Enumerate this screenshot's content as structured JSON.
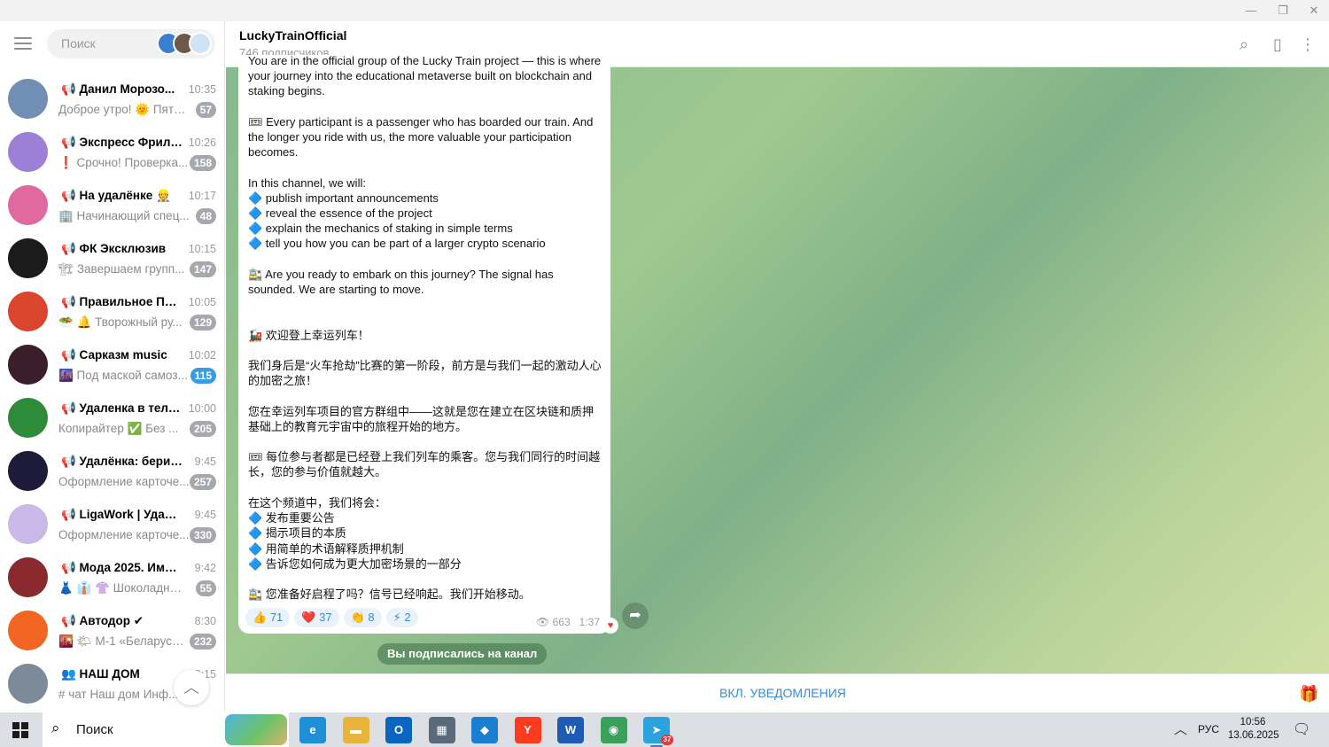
{
  "window": {
    "minimize": "—",
    "maximize": "❐",
    "close": "✕"
  },
  "sidebar": {
    "search_placeholder": "Поиск",
    "chats": [
      {
        "name": "📢 Данил Морозо...",
        "time": "10:35",
        "preview": "Доброе утро! 🌞 Пятн...",
        "unread": "57",
        "avatar_color": "#6f8fb4",
        "badge_color": "#a5a9ae"
      },
      {
        "name": "📢 Экспресс Фриланс",
        "time": "10:26",
        "preview": "❗ Срочно! Проверка...",
        "unread": "158",
        "avatar_color": "#9c7fd6",
        "badge_color": "#a5a9ae"
      },
      {
        "name": "📢 На удалёнке 👷",
        "time": "10:17",
        "preview": "🏢 Начинающий спец...",
        "unread": "48",
        "avatar_color": "#e06aa0",
        "badge_color": "#a5a9ae"
      },
      {
        "name": "📢 ФК Эксклюзив",
        "time": "10:15",
        "preview": "🏗 Завершаем групп...",
        "unread": "147",
        "avatar_color": "#1b1b1b",
        "badge_color": "#a5a9ae"
      },
      {
        "name": "📢 Правильное Пита...",
        "time": "10:05",
        "preview": "🥗 🔔 Творожный ру...",
        "unread": "129",
        "avatar_color": "#d9462d",
        "badge_color": "#a5a9ae"
      },
      {
        "name": "📢 Сарказм music",
        "time": "10:02",
        "preview": "🌆 Под маской самоз...",
        "unread": "115",
        "avatar_color": "#3a1f2b",
        "badge_color": "#3b9be0"
      },
      {
        "name": "📢 Удаленка в телеф...",
        "time": "10:00",
        "preview": "Копирайтер ✅ Без ...",
        "unread": "205",
        "avatar_color": "#2e8b3a",
        "badge_color": "#a5a9ae"
      },
      {
        "name": "📢 Удалёнка: бери и д...",
        "time": "9:45",
        "preview": "Оформление карточе...",
        "unread": "257",
        "avatar_color": "#1e1b3a",
        "badge_color": "#a5a9ae"
      },
      {
        "name": "📢 LigaWork | Удалёнк...",
        "time": "9:45",
        "preview": "Оформление карточе...",
        "unread": "330",
        "avatar_color": "#c9b8e8",
        "badge_color": "#a5a9ae"
      },
      {
        "name": "📢 Мода 2025. Имидж ...",
        "time": "9:42",
        "preview": "👗 👔 👚 Шоколадный ...",
        "unread": "55",
        "avatar_color": "#8a2a2e",
        "badge_color": "#a5a9ae"
      },
      {
        "name": "📢 Автодор ✔",
        "time": "8:30",
        "preview": "🌇 🌤 М-1 «Беларусь»...",
        "unread": "232",
        "avatar_color": "#f26522",
        "badge_color": "#a5a9ae"
      },
      {
        "name": "👥 НАШ ДОМ",
        "time": "8:15",
        "preview": "# чат Наш дом   Инф...",
        "unread": "",
        "avatar_color": "#7d8a99",
        "badge_color": "#a5a9ae"
      }
    ]
  },
  "header": {
    "title": "LuckyTrainOfficial",
    "subtitle": "746 подписчиков"
  },
  "message": {
    "text": "You are in the official group of the Lucky Train project — this is where your journey into the educational metaverse built on blockchain and staking begins.\n\n🎟 Every participant is a passenger who has boarded our train. And the longer you ride with us, the more valuable your participation becomes.\n\nIn this channel, we will:\n🔷 publish important announcements\n🔷 reveal the essence of the project\n🔷 explain the mechanics of staking in simple terms\n🔷 tell you how you can be part of a larger crypto scenario\n\n🚉 Are you ready to embark on this journey? The signal has sounded. We are starting to move.\n\n\n🚂 欢迎登上幸运列车！\n\n我们身后是“火车抢劫”比赛的第一阶段，前方是与我们一起的激动人心的加密之旅！\n\n您在幸运列车项目的官方群组中——这就是您在建立在区块链和质押基础上的教育元宇宙中的旅程开始的地方。\n\n🎟 每位参与者都是已经登上我们列车的乘客。您与我们同行的时间越长，您的参与价值就越大。\n\n在这个频道中，我们将会：\n🔷 发布重要公告\n🔷 揭示项目的本质\n🔷 用简单的术语解释质押机制\n🔷 告诉您如何成为更大加密场景的一部分\n\n🚉 您准备好启程了吗？信号已经响起。我们开始移动。",
    "reactions": [
      {
        "emoji": "👍",
        "count": "71"
      },
      {
        "emoji": "❤️",
        "count": "37"
      },
      {
        "emoji": "👏",
        "count": "8"
      },
      {
        "emoji": "⚡",
        "count": "2"
      }
    ],
    "views": "663",
    "time": "1:37"
  },
  "service_message": "Вы подписались на канал",
  "bottom": {
    "notifications_button": "ВКЛ. УВЕДОМЛЕНИЯ"
  },
  "taskbar": {
    "search_label": "Поиск",
    "apps": [
      {
        "name": "edge",
        "label": "e",
        "color": "#1f8fd6",
        "active": false
      },
      {
        "name": "explorer",
        "label": "▬",
        "color": "#e8b53a",
        "active": false
      },
      {
        "name": "outlook",
        "label": "O",
        "color": "#0a64c2",
        "active": false
      },
      {
        "name": "calculator",
        "label": "▦",
        "color": "#5b6a7a",
        "active": false
      },
      {
        "name": "vscode",
        "label": "◆",
        "color": "#1a7fd0",
        "active": false
      },
      {
        "name": "yandex",
        "label": "Y",
        "color": "#ff3b1f",
        "active": false
      },
      {
        "name": "word",
        "label": "W",
        "color": "#1f5bb5",
        "active": false
      },
      {
        "name": "chrome",
        "label": "◉",
        "color": "#3aa05a",
        "active": false
      },
      {
        "name": "telegram",
        "label": "➤",
        "color": "#2aa3df",
        "active": true,
        "badge": "37"
      }
    ],
    "language": "РУС",
    "time": "10:56",
    "date": "13.06.2025"
  }
}
